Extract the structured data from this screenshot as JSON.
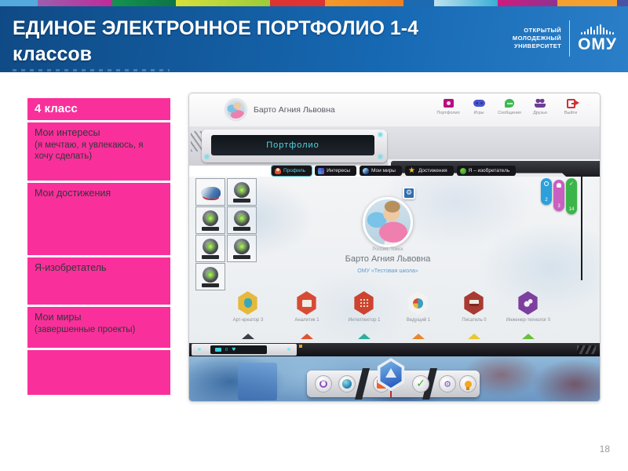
{
  "slide": {
    "title_line1": "ЕДИНОЕ ЭЛЕКТРОННОЕ ПОРТФОЛИО 1-4",
    "title_line2": "классов",
    "page_number": "18",
    "logo": {
      "org_line1": "ОТКРЫТЫЙ",
      "org_line2": "МОЛОДЕЖНЫЙ",
      "org_line3": "УНИВЕРСИТЕТ",
      "brand": "ОМУ"
    }
  },
  "colors": {
    "header_blue": "#1668b2",
    "sidebar_pink": "#f9309b",
    "teal_accent": "#4fd6e0",
    "pill_blue": "#2da0dc",
    "pill_magenta": "#c95fc1",
    "pill_green": "#3bb54a"
  },
  "sidebar": {
    "items": [
      {
        "label": "4 класс",
        "sub": ""
      },
      {
        "label": "Мои интересы",
        "sub": "(я мечтаю, я увлекаюсь, я хочу сделать)"
      },
      {
        "label": "Мои достижения",
        "sub": ""
      },
      {
        "label": "Я-изобретатель",
        "sub": ""
      },
      {
        "label": "Мои миры",
        "sub": "(завершенные проекты)"
      },
      {
        "label": "",
        "sub": ""
      }
    ]
  },
  "portal": {
    "user_name": "Барто Агния Львовна",
    "nav": [
      {
        "label": "Портфолио"
      },
      {
        "label": "Игры"
      },
      {
        "label": "Сообщения"
      },
      {
        "label": "Друзья"
      },
      {
        "label": "Выйти"
      }
    ],
    "device_title": "Портфолио",
    "tabs": [
      {
        "label": "Профиль"
      },
      {
        "label": "Интересы"
      },
      {
        "label": "Мои миры"
      },
      {
        "label": "Достижения"
      },
      {
        "label": "Я – изобретатель"
      }
    ],
    "profile": {
      "location": "Россия, Томск",
      "name": "Барто Агния Львовна",
      "school": "ОМУ «Тестовая школа»"
    },
    "side_pills": [
      {
        "count": "2"
      },
      {
        "count": "3"
      },
      {
        "count": "14"
      }
    ],
    "badges": [
      {
        "label": "Арт-креатор 3"
      },
      {
        "label": "Аналитик 1"
      },
      {
        "label": "Интеллектор 1"
      },
      {
        "label": "Ведущий 1"
      },
      {
        "label": "Писатель 0"
      },
      {
        "label": "Инженер-технолог 0"
      }
    ],
    "mini_screen_value": "0"
  },
  "icons": {
    "close": "×",
    "gear": "⚙",
    "star": "★",
    "check": "✓",
    "heart": "♥"
  }
}
